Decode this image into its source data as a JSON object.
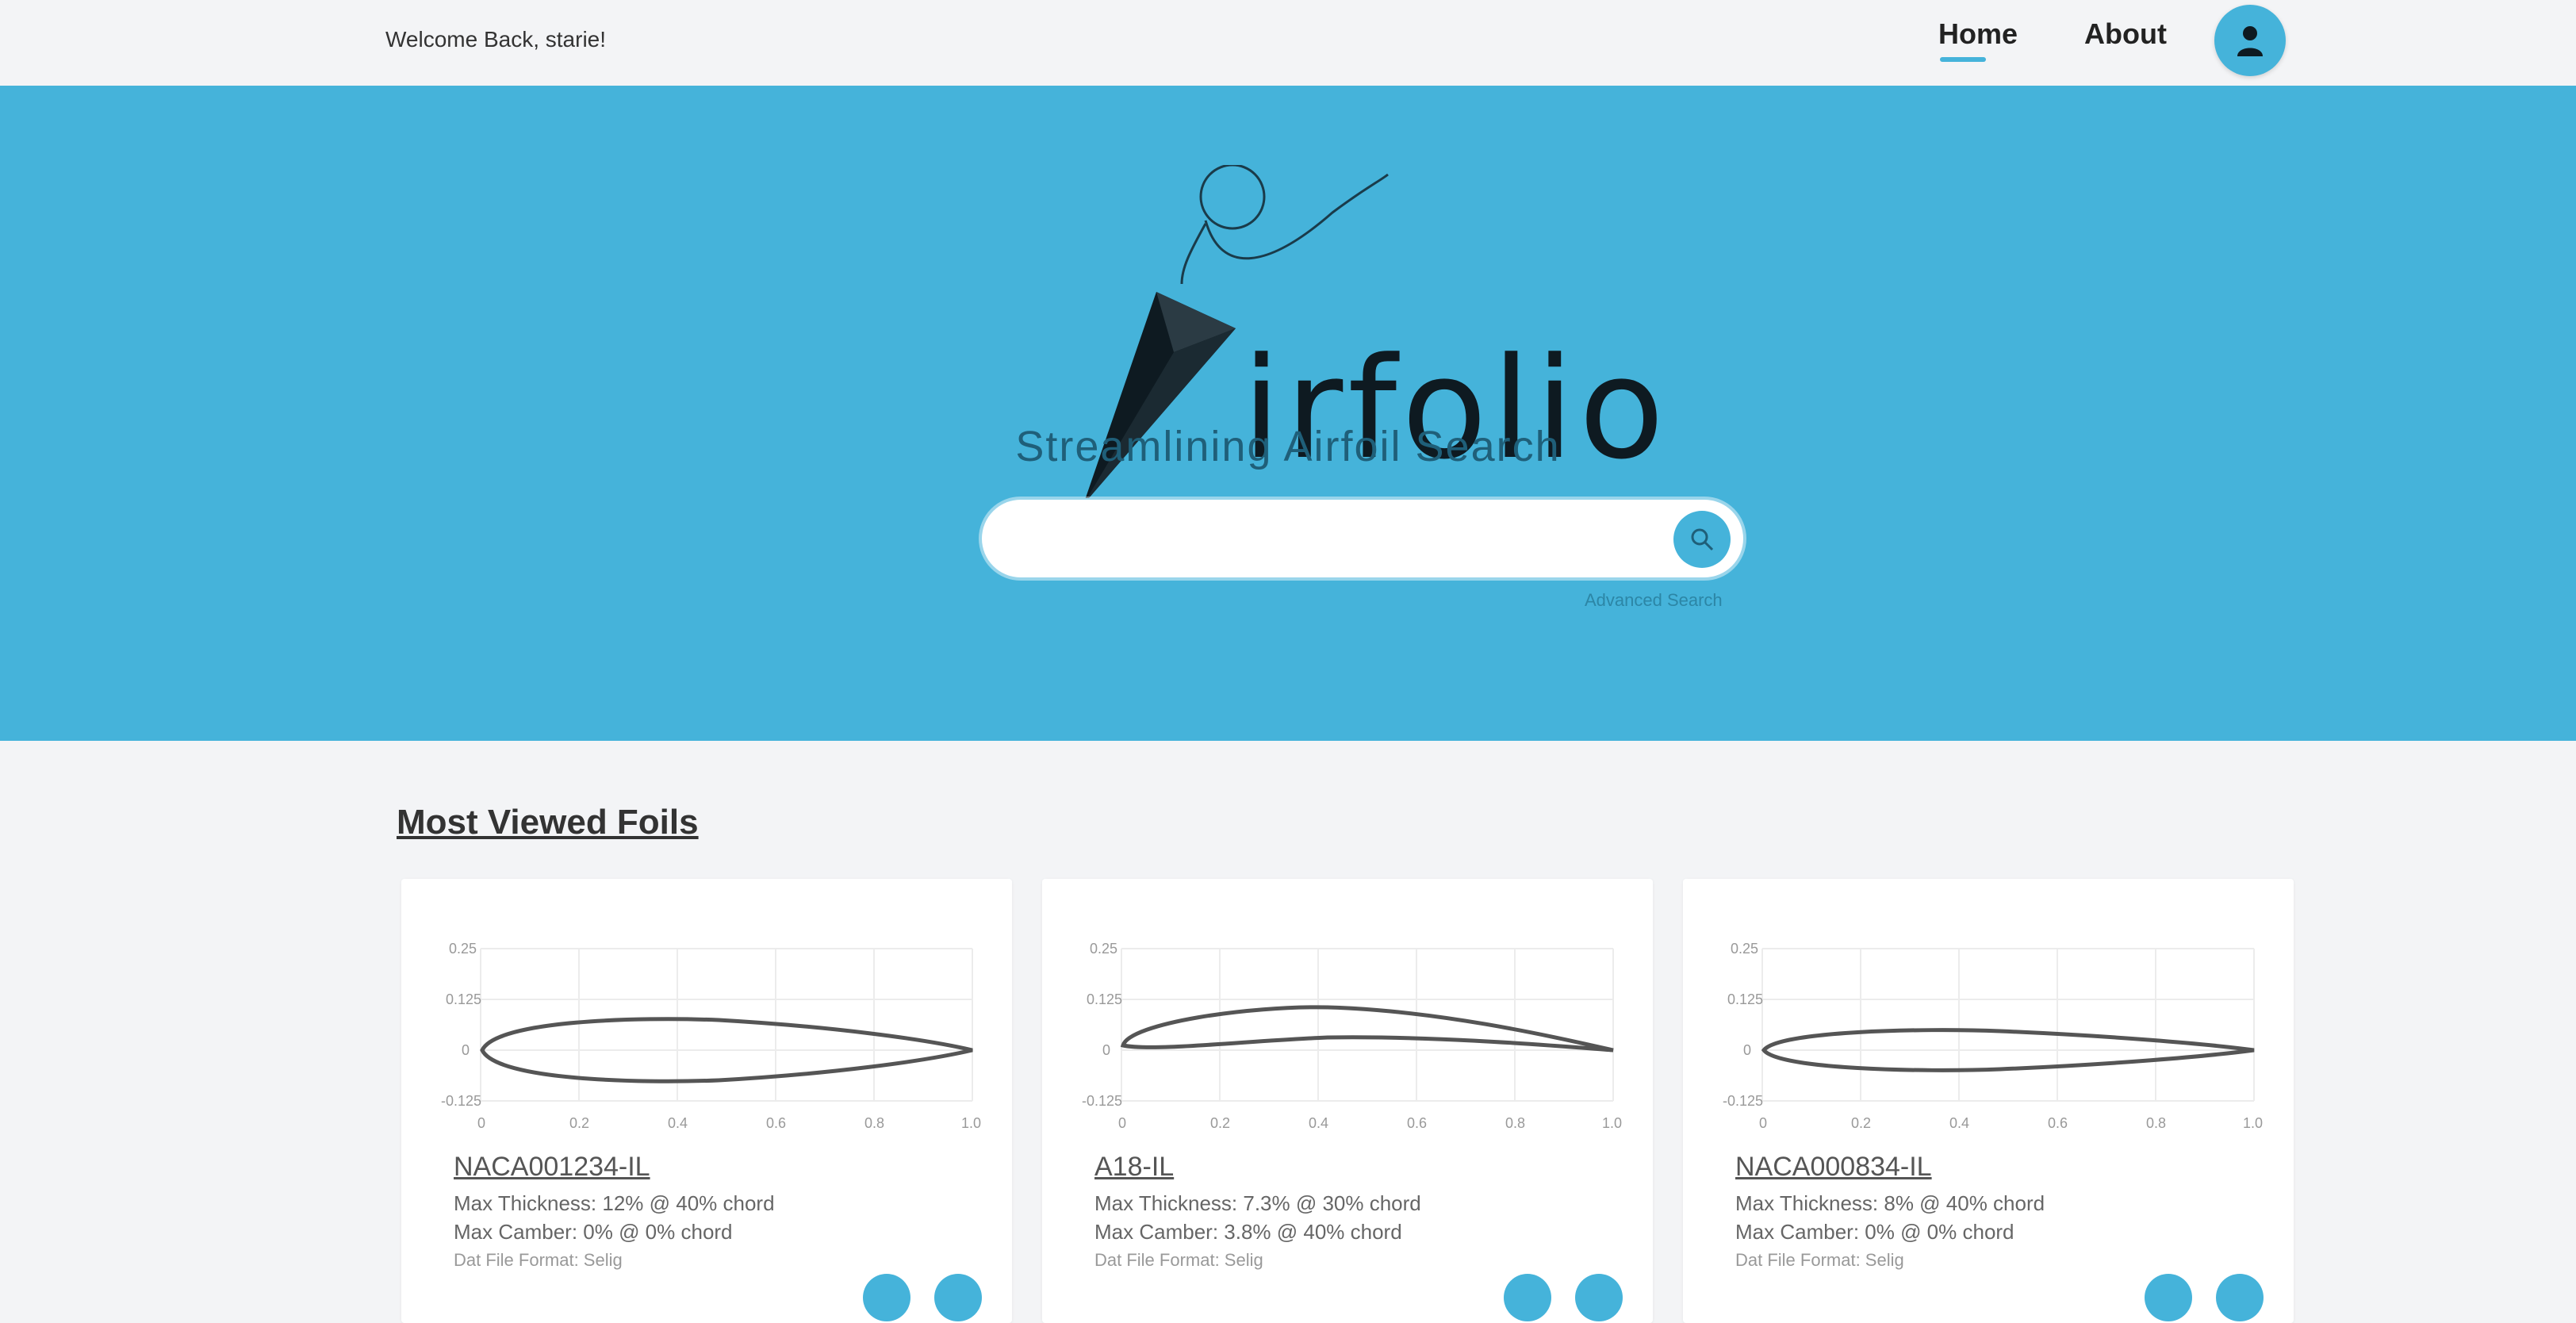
{
  "header": {
    "welcome": "Welcome Back, starie!",
    "nav": {
      "home": "Home",
      "about": "About"
    },
    "avatar_icon": "user-icon"
  },
  "hero": {
    "logo_text": "irfolio",
    "tagline": "Streamlining Airfoil Search",
    "search_placeholder": "",
    "search_icon": "search-icon",
    "advanced_link": "Advanced Search",
    "accent": "#45b3da"
  },
  "section": {
    "title": "Most Viewed Foils"
  },
  "cards": [
    {
      "name": "NACA001234-IL",
      "max_thickness": "Max Thickness: 12% @ 40% chord",
      "max_camber": "Max Camber: 0% @ 0% chord",
      "format": "Dat File Format: Selig",
      "y_ticks": [
        "0.25",
        "0.125",
        "0",
        "-0.125"
      ],
      "x_ticks": [
        "0",
        "0.2",
        "0.4",
        "0.6",
        "0.8",
        "1.0"
      ]
    },
    {
      "name": "A18-IL",
      "max_thickness": "Max Thickness: 7.3% @ 30% chord",
      "max_camber": "Max Camber: 3.8% @ 40% chord",
      "format": "Dat File Format: Selig",
      "y_ticks": [
        "0.25",
        "0.125",
        "0",
        "-0.125"
      ],
      "x_ticks": [
        "0",
        "0.2",
        "0.4",
        "0.6",
        "0.8",
        "1.0"
      ]
    },
    {
      "name": "NACA000834-IL",
      "max_thickness": "Max Thickness: 8% @ 40% chord",
      "max_camber": "Max Camber: 0% @ 0% chord",
      "format": "Dat File Format: Selig",
      "y_ticks": [
        "0.25",
        "0.125",
        "0",
        "-0.125"
      ],
      "x_ticks": [
        "0",
        "0.2",
        "0.4",
        "0.6",
        "0.8",
        "1.0"
      ]
    }
  ]
}
